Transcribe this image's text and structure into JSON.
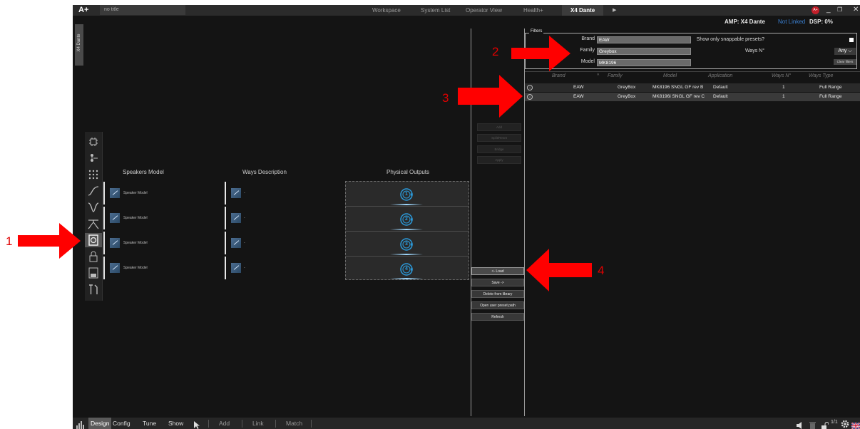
{
  "app": {
    "logo": "A+",
    "project_title": "no title",
    "tabs": [
      "Workspace",
      "System List",
      "Operator View",
      "Health+",
      "X4 Dante"
    ],
    "play_icon": "play-icon",
    "user_badge": "A+",
    "window_controls": [
      "_",
      "❐",
      "✕"
    ]
  },
  "status": {
    "amp": "AMP: X4 Dante",
    "link": "Not Linked",
    "dsp": "DSP:  0%"
  },
  "colors": {
    "accent_blue": "#2b9adb",
    "annotation_red": "#e00000",
    "link_blue": "#3a7fd0"
  },
  "device_tab": "X4 Dante",
  "left_icons": [
    "chip-icon",
    "routing-icon",
    "matrix-icon",
    "filter-icon",
    "eq-icon",
    "crossover-icon",
    "speaker-preset-icon",
    "lock-icon",
    "save-icon",
    "tools-icon"
  ],
  "columns": {
    "speakers_model": "Speakers Model",
    "ways_description": "Ways Description",
    "physical_outputs": "Physical Outputs"
  },
  "rows": [
    {
      "model": "Speaker Model",
      "ways": "-",
      "output": "1"
    },
    {
      "model": "Speaker Model",
      "ways": "-",
      "output": "2"
    },
    {
      "model": "Speaker Model",
      "ways": "-",
      "output": "3"
    },
    {
      "model": "Speaker Model",
      "ways": "-",
      "output": "4"
    }
  ],
  "disabled_buttons": [
    "Add",
    "Split/Reset",
    "Bridge",
    "Apply"
  ],
  "action_buttons": [
    "<- Load",
    "Save ->",
    "Delete from library",
    "Open user preset path",
    "Refresh"
  ],
  "filters": {
    "legend": "Filters",
    "brand_label": "Brand",
    "brand_value": "EAW",
    "family_label": "Family",
    "family_value": "Greybox",
    "model_label": "Model",
    "model_value": "MK8196",
    "snappable_label": "Show only snappable presets?",
    "snappable_checked": false,
    "ways_label": "Ways N°",
    "ways_value": "Any",
    "clear_label": "Clear filters"
  },
  "table": {
    "headers": [
      "Brand",
      "Family",
      "Model",
      "Application",
      "Ways N°",
      "Ways Type"
    ],
    "rows": [
      {
        "brand": "EAW",
        "family": "GreyBox",
        "model": "MK8196 SNGL GF rev B",
        "application": "Default",
        "ways": "1",
        "type": "Full Range"
      },
      {
        "brand": "EAW",
        "family": "GreyBox",
        "model": "MK8196i SNGL GF rev C",
        "application": "Default",
        "ways": "1",
        "type": "Full Range"
      }
    ]
  },
  "bottom": {
    "tabs": [
      "Design",
      "Config",
      "Tune",
      "Show"
    ],
    "tools": [
      "Add",
      "Link",
      "Match"
    ],
    "page_indicator": "1/1"
  },
  "annotations": [
    "1",
    "2",
    "3",
    "4"
  ]
}
